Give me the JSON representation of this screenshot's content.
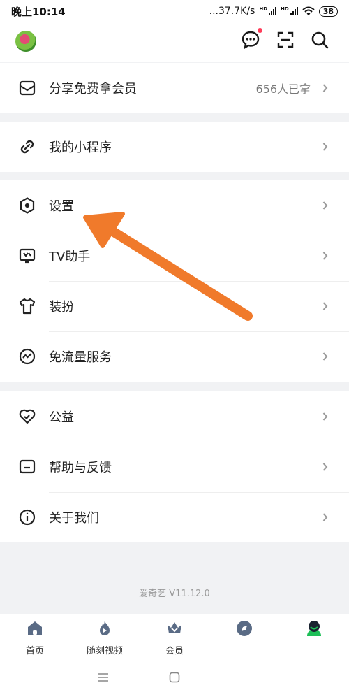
{
  "status_bar": {
    "time": "晚上10:14",
    "network": "...37.7K/s",
    "hd1": "HD",
    "hd2": "HD",
    "battery": "38"
  },
  "header": {
    "avatar": "user-avatar",
    "icons": [
      "chat-icon",
      "scan-icon",
      "search-icon"
    ],
    "has_notification": true
  },
  "share_item": {
    "label": "分享免费拿会员",
    "extra": "656人已拿"
  },
  "mini_item": {
    "label": "我的小程序"
  },
  "settings_group": [
    {
      "label": "设置",
      "icon": "hexagon-icon"
    },
    {
      "label": "TV助手",
      "icon": "tv-icon"
    },
    {
      "label": "装扮",
      "icon": "shirt-icon"
    },
    {
      "label": "免流量服务",
      "icon": "traffic-icon"
    }
  ],
  "help_group": [
    {
      "label": "公益",
      "icon": "heart-icon"
    },
    {
      "label": "帮助与反馈",
      "icon": "feedback-icon"
    },
    {
      "label": "关于我们",
      "icon": "info-icon"
    }
  ],
  "version": "爱奇艺 V11.12.0",
  "tabs": [
    {
      "label": "首页",
      "icon": "home-icon"
    },
    {
      "label": "随刻视频",
      "icon": "flame-icon"
    },
    {
      "label": "会员",
      "icon": "crown-icon"
    },
    {
      "label": "",
      "icon": "compass-icon"
    },
    {
      "label": "",
      "icon": "profile-icon"
    }
  ],
  "colors": {
    "accent": "#1dbf57",
    "arrow": "#f07a2b",
    "text": "#222222",
    "muted": "#777777",
    "tab_icon": "#5a6b85"
  }
}
